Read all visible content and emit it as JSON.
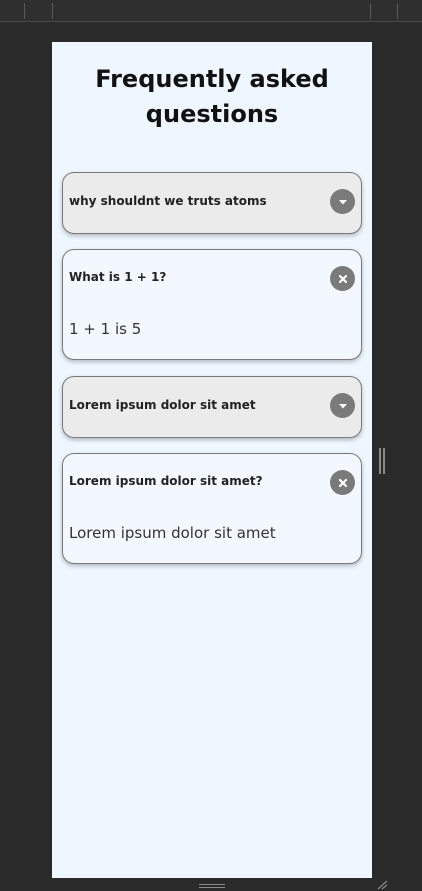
{
  "page": {
    "title": "Frequently asked questions"
  },
  "faqs": [
    {
      "question": "why shouldnt we truts atoms",
      "answer": "",
      "state": "collapsed"
    },
    {
      "question": "What is 1 + 1?",
      "answer": "1 + 1 is 5",
      "state": "expanded"
    },
    {
      "question": "Lorem ipsum dolor sit amet",
      "answer": "",
      "state": "collapsed"
    },
    {
      "question": "Lorem ipsum dolor sit amet?",
      "answer": "Lorem ipsum dolor sit amet",
      "state": "expanded"
    }
  ],
  "icons": {
    "collapsed": "chevron-down-icon",
    "expanded": "close-icon"
  },
  "colors": {
    "page_bg": "#eef6ff",
    "card_closed_bg": "#ebebeb",
    "card_open_bg": "#f3f8ff",
    "button_bg": "#7a7a7a",
    "frame_bg": "#2a2a2a"
  }
}
